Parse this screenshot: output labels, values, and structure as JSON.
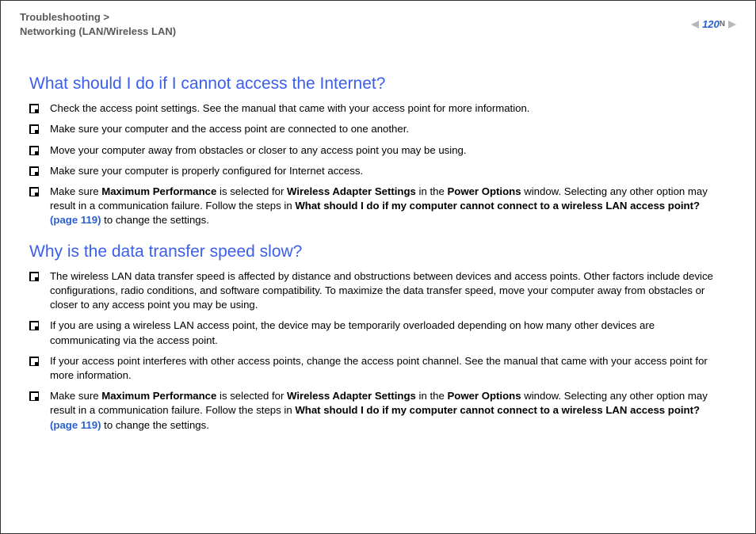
{
  "header": {
    "breadcrumb_line1": "Troubleshooting >",
    "breadcrumb_line2": "Networking (LAN/Wireless LAN)",
    "page_number": "120",
    "nav_letter": "N"
  },
  "section1": {
    "title": "What should I do if I cannot access the Internet?",
    "items": {
      "0": "Check the access point settings. See the manual that came with your access point for more information.",
      "1": "Make sure your computer and the access point are connected to one another.",
      "2": "Move your computer away from obstacles or closer to any access point you may be using.",
      "3": "Make sure your computer is properly configured for Internet access.",
      "4": {
        "pre": "Make sure ",
        "b1": "Maximum Performance",
        "mid1": " is selected for ",
        "b2": "Wireless Adapter Settings",
        "mid2": " in the ",
        "b3": "Power Options",
        "mid3": " window. Selecting any other option may result in a communication failure. Follow the steps in ",
        "b4": "What should I do if my computer cannot connect to a wireless LAN access point? ",
        "link": "(page 119)",
        "post": " to change the settings."
      }
    }
  },
  "section2": {
    "title": "Why is the data transfer speed slow?",
    "items": {
      "0": "The wireless LAN data transfer speed is affected by distance and obstructions between devices and access points. Other factors include device configurations, radio conditions, and software compatibility. To maximize the data transfer speed, move your computer away from obstacles or closer to any access point you may be using.",
      "1": "If you are using a wireless LAN access point, the device may be temporarily overloaded depending on how many other devices are communicating via the access point.",
      "2": "If your access point interferes with other access points, change the access point channel. See the manual that came with your access point for more information.",
      "3": {
        "pre": "Make sure ",
        "b1": "Maximum Performance",
        "mid1": " is selected for ",
        "b2": "Wireless Adapter Settings",
        "mid2": " in the ",
        "b3": "Power Options",
        "mid3": " window. Selecting any other option may result in a communication failure. Follow the steps in ",
        "b4": "What should I do if my computer cannot connect to a wireless LAN access point? ",
        "link": "(page 119)",
        "post": " to change the settings."
      }
    }
  }
}
